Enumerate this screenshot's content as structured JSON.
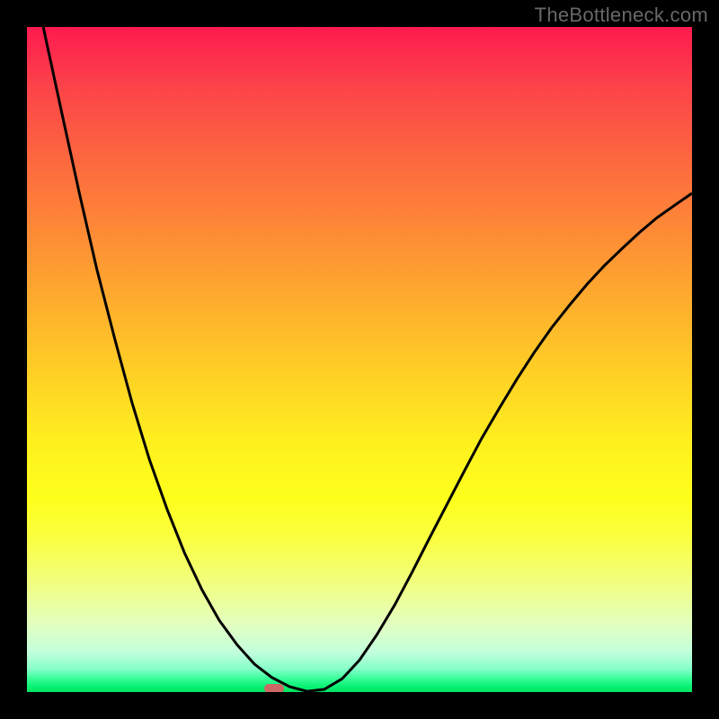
{
  "watermark": "TheBottleneck.com",
  "chart_data": {
    "type": "line",
    "title": "",
    "xlabel": "",
    "ylabel": "",
    "xlim": [
      0,
      1
    ],
    "ylim": [
      0,
      1
    ],
    "gradient_stops": [
      {
        "pct": 0,
        "color": "#fd1b4f"
      },
      {
        "pct": 9,
        "color": "#fc4349"
      },
      {
        "pct": 21,
        "color": "#fd6b3e"
      },
      {
        "pct": 31,
        "color": "#fe8b36"
      },
      {
        "pct": 42,
        "color": "#feaf2d"
      },
      {
        "pct": 53,
        "color": "#fed324"
      },
      {
        "pct": 63,
        "color": "#fef11e"
      },
      {
        "pct": 71,
        "color": "#feff1d"
      },
      {
        "pct": 77,
        "color": "#faff41"
      },
      {
        "pct": 84,
        "color": "#f0ff84"
      },
      {
        "pct": 90,
        "color": "#e2ffc2"
      },
      {
        "pct": 94,
        "color": "#c2ffdc"
      },
      {
        "pct": 96.5,
        "color": "#87ffca"
      },
      {
        "pct": 98,
        "color": "#37fd9a"
      },
      {
        "pct": 99.2,
        "color": "#08f173"
      },
      {
        "pct": 100,
        "color": "#05e261"
      }
    ],
    "x": [
      0.0,
      0.026,
      0.053,
      0.079,
      0.105,
      0.132,
      0.158,
      0.184,
      0.211,
      0.237,
      0.263,
      0.289,
      0.316,
      0.342,
      0.368,
      0.395,
      0.421,
      0.447,
      0.474,
      0.5,
      0.526,
      0.553,
      0.579,
      0.605,
      0.632,
      0.658,
      0.684,
      0.711,
      0.737,
      0.763,
      0.789,
      0.816,
      0.842,
      0.868,
      0.895,
      0.921,
      0.947,
      0.974,
      1.0
    ],
    "values": [
      1.12,
      0.993,
      0.868,
      0.749,
      0.636,
      0.531,
      0.435,
      0.35,
      0.274,
      0.209,
      0.154,
      0.108,
      0.071,
      0.042,
      0.022,
      0.008,
      0.001,
      0.004,
      0.02,
      0.048,
      0.086,
      0.131,
      0.18,
      0.231,
      0.283,
      0.333,
      0.382,
      0.428,
      0.471,
      0.511,
      0.548,
      0.582,
      0.613,
      0.641,
      0.667,
      0.691,
      0.713,
      0.732,
      0.75
    ],
    "marker": {
      "x": 0.372,
      "y": 0.005,
      "color": "#cc6766"
    }
  }
}
